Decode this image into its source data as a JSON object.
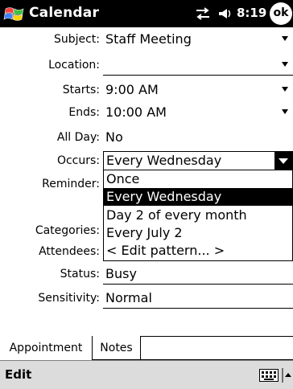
{
  "titlebar": {
    "title": "Calendar",
    "time": "8:19",
    "ok_label": "ok",
    "icons": [
      "start-flag-icon",
      "connectivity-icon",
      "volume-icon"
    ]
  },
  "form": {
    "subject": {
      "label": "Subject:",
      "value": "Staff Meeting"
    },
    "location": {
      "label": "Location:",
      "value": ""
    },
    "starts": {
      "label": "Starts:",
      "value": "9:00 AM"
    },
    "ends": {
      "label": "Ends:",
      "value": "10:00 AM"
    },
    "all_day": {
      "label": "All Day:",
      "value": "No"
    },
    "occurs": {
      "label": "Occurs:",
      "value": "Every Wednesday"
    },
    "reminder": {
      "label": "Reminder:"
    },
    "categories": {
      "label": "Categories:"
    },
    "attendees": {
      "label": "Attendees:"
    },
    "status": {
      "label": "Status:",
      "value": "Busy"
    },
    "sensitivity": {
      "label": "Sensitivity:",
      "value": "Normal"
    }
  },
  "occurs_options": [
    {
      "label": "Once",
      "selected": false
    },
    {
      "label": "Every Wednesday",
      "selected": true
    },
    {
      "label": "Day 2 of every month",
      "selected": false
    },
    {
      "label": "Every July 2",
      "selected": false
    },
    {
      "label": "< Edit pattern... >",
      "selected": false
    }
  ],
  "tabs": [
    {
      "label": "Appointment",
      "active": true
    },
    {
      "label": "Notes",
      "active": false
    }
  ],
  "menubar": {
    "edit_label": "Edit",
    "icons": [
      "keyboard-icon",
      "input-menu-arrow-icon"
    ]
  }
}
